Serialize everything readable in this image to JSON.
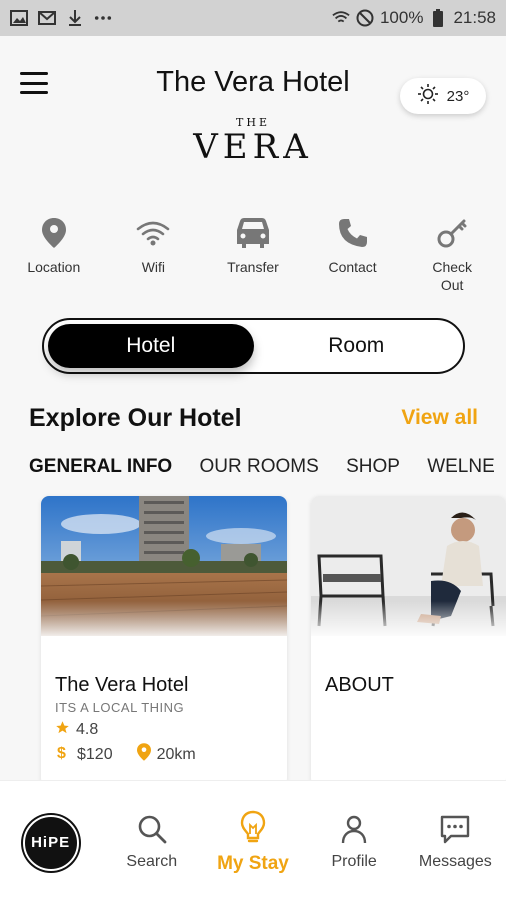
{
  "status_bar": {
    "left_icons": [
      "image-icon",
      "gmail-icon",
      "download-icon",
      "more-icon"
    ],
    "battery": "100%",
    "time": "21:58"
  },
  "header": {
    "title": "The Vera Hotel",
    "weather_temp": "23°",
    "logo_top": "THE",
    "logo_main": "VERA"
  },
  "actions": [
    {
      "label": "Location",
      "icon": "location-pin-icon"
    },
    {
      "label": "Wifi",
      "icon": "wifi-icon"
    },
    {
      "label": "Transfer",
      "icon": "car-icon"
    },
    {
      "label": "Contact",
      "icon": "phone-icon"
    },
    {
      "label": "Check Out",
      "icon": "key-icon"
    }
  ],
  "toggle": {
    "options": [
      "Hotel",
      "Room"
    ],
    "selected": "Hotel"
  },
  "explore": {
    "title": "Explore Our Hotel",
    "view_all": "View all",
    "categories": [
      "GENERAL INFO",
      "OUR ROOMS",
      "SHOP",
      "WELNE"
    ],
    "active_category": "GENERAL INFO"
  },
  "cards": [
    {
      "title": "The Vera Hotel",
      "subtitle": "ITS A LOCAL THING",
      "rating": "4.8",
      "price": "$120",
      "distance": "20km"
    },
    {
      "title": "ABOUT"
    }
  ],
  "bottom_nav": [
    {
      "label": "HiPE",
      "icon": "hipe-logo"
    },
    {
      "label": "Search",
      "icon": "search-icon"
    },
    {
      "label": "My Stay",
      "icon": "lightbulb-icon"
    },
    {
      "label": "Profile",
      "icon": "profile-icon"
    },
    {
      "label": "Messages",
      "icon": "messages-icon"
    }
  ],
  "colors": {
    "accent": "#f0a412",
    "dark": "#111111",
    "background": "#f7f7f7"
  }
}
